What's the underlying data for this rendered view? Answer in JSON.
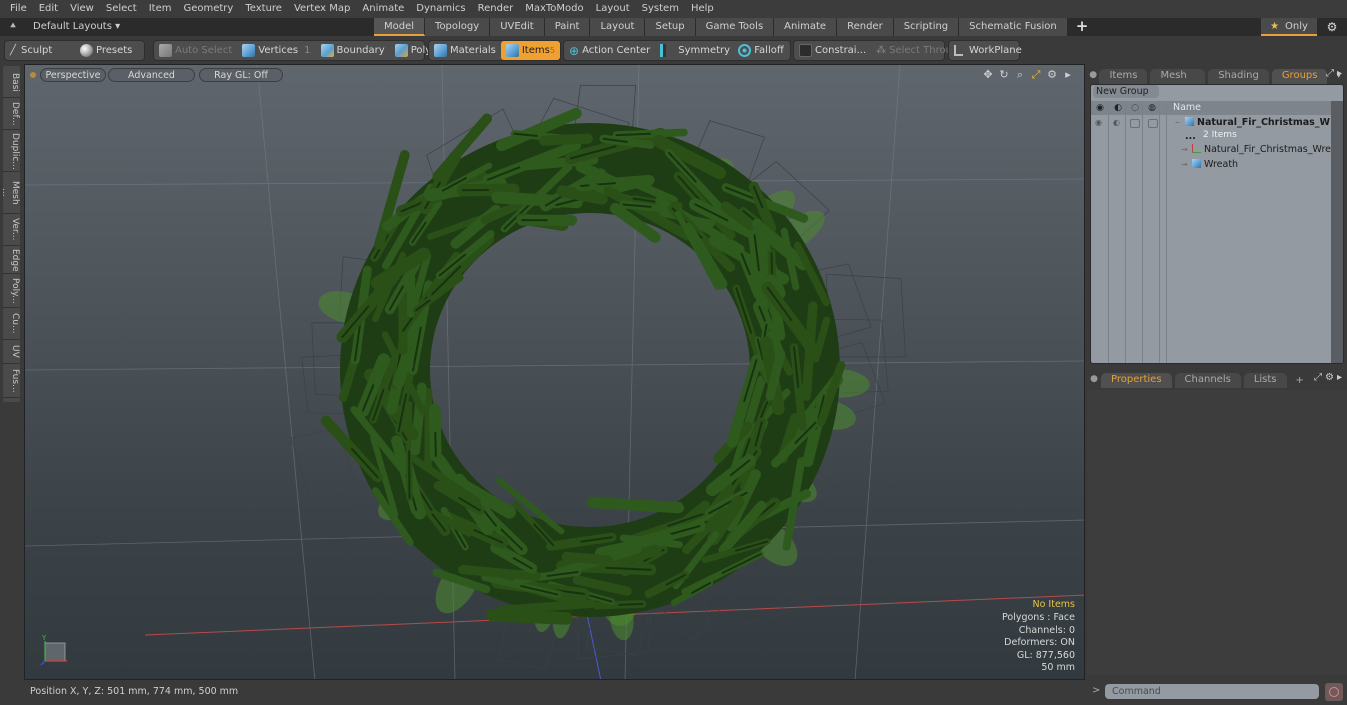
{
  "menu": [
    "File",
    "Edit",
    "View",
    "Select",
    "Item",
    "Geometry",
    "Texture",
    "Vertex Map",
    "Animate",
    "Dynamics",
    "Render",
    "MaxToModo",
    "Layout",
    "System",
    "Help"
  ],
  "layoutbar": {
    "layouts_label": "Default Layouts ▾",
    "tabs": [
      "Model",
      "Topology",
      "UVEdit",
      "Paint",
      "Layout",
      "Setup",
      "Game Tools",
      "Animate",
      "Render",
      "Scripting",
      "Schematic Fusion"
    ],
    "active_tab": "Model",
    "add_label": "+",
    "only_label": "Only"
  },
  "toolbar": {
    "sculpt": "Sculpt",
    "presets": "Presets",
    "auto_select": "Auto Select",
    "vertices": "Vertices",
    "vertices_count": "1",
    "boundary": "Boundary",
    "polygons": "Polygons",
    "materials": "Materials",
    "items": "Items",
    "items_count": "5",
    "action_center": "Action Center",
    "symmetry": "Symmetry",
    "falloff": "Falloff",
    "constraints": "Constrai...",
    "select_through": "Select Through",
    "workplane": "WorkPlane"
  },
  "left_tabs": [
    "Basi",
    "Def...",
    "Duplic...",
    "Mesh ...",
    "Ver...",
    "Edge",
    "Poly...",
    "Cu...",
    "UV",
    "Fus..."
  ],
  "viewport": {
    "view_mode": "Perspective",
    "shading": "Advanced",
    "raygl": "Ray GL: Off",
    "stats": {
      "selection": "No Items",
      "polygons": "Polygons : Face",
      "channels": "Channels: 0",
      "deformers": "Deformers: ON",
      "gl": "GL: 877,560",
      "grid": "50 mm"
    },
    "axis_y": "Y"
  },
  "statusbar": {
    "position": "Position X, Y, Z:   501 mm, 774 mm, 500 mm"
  },
  "groups_panel": {
    "tabs": [
      "Items",
      "Mesh ...",
      "Shading",
      "Groups"
    ],
    "active_tab": "Groups",
    "new_group": "New Group",
    "name_header": "Name",
    "tree": [
      {
        "label": "Natural_Fir_Christmas_W ...",
        "sub": "2 Items",
        "type": "group"
      },
      {
        "label": "Natural_Fir_Christmas_Wre ...",
        "type": "locator"
      },
      {
        "label": "Wreath",
        "type": "mesh"
      }
    ]
  },
  "properties_panel": {
    "tabs": [
      "Properties",
      "Channels",
      "Lists"
    ],
    "active_tab": "Properties",
    "add_label": "+"
  },
  "command": {
    "prompt": ">",
    "placeholder": "Command"
  },
  "colors": {
    "accent": "#e8a13a",
    "active_tool": "#f0a030",
    "stats_warning": "#e8c24a",
    "wreath_dark": "#1f3d14",
    "wreath_mid": "#2f5a1e",
    "wreath_light": "#4c8a2e"
  }
}
